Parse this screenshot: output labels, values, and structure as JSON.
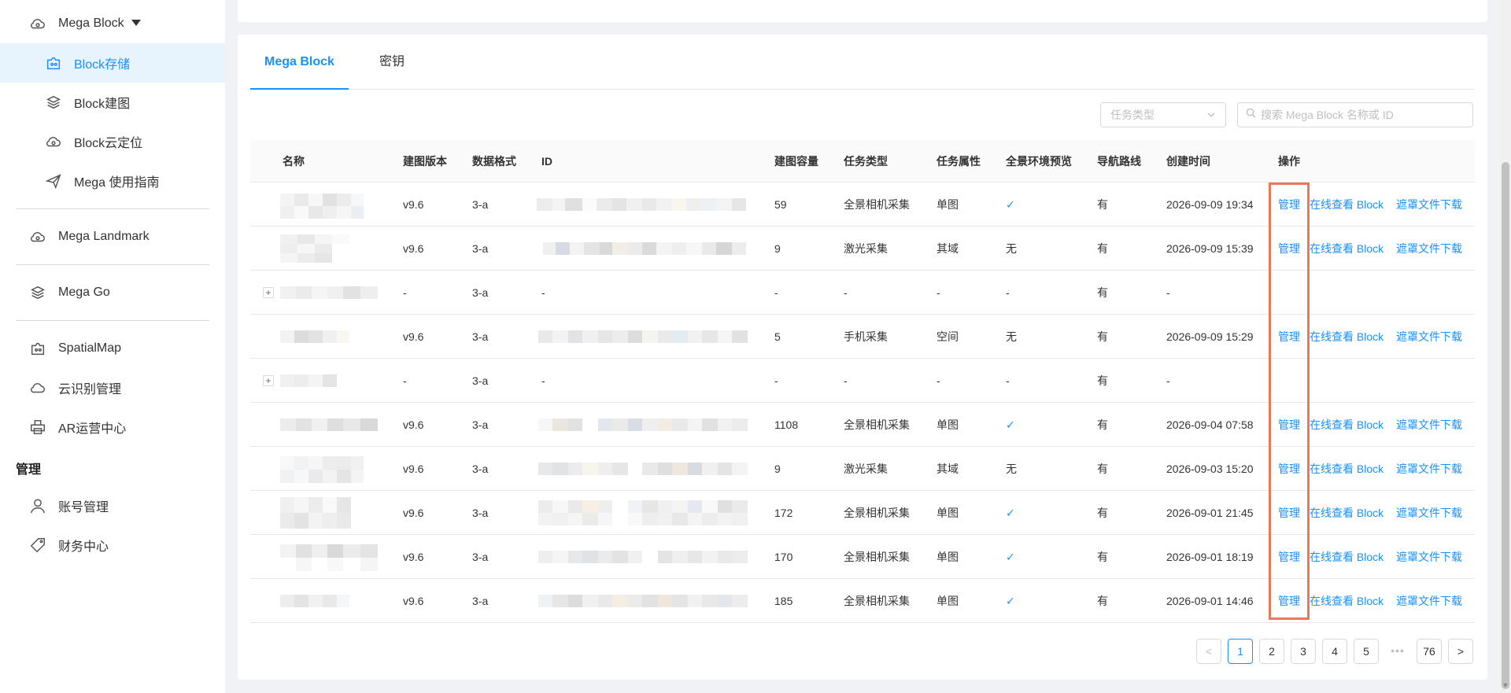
{
  "sidebar": {
    "items": [
      {
        "label": "Mega Block",
        "icon": "cloud-icon"
      },
      {
        "label": "Block存储",
        "icon": "block-storage-icon"
      },
      {
        "label": "Block建图",
        "icon": "layers-icon"
      },
      {
        "label": "Block云定位",
        "icon": "cloud-icon"
      },
      {
        "label": "Mega 使用指南",
        "icon": "send-icon"
      },
      {
        "label": "Mega Landmark",
        "icon": "cloud-icon"
      },
      {
        "label": "Mega Go",
        "icon": "layers-icon"
      },
      {
        "label": "SpatialMap",
        "icon": "spatial-icon"
      },
      {
        "label": "云识别管理",
        "icon": "cloud-outline-icon"
      },
      {
        "label": "AR运营中心",
        "icon": "printer-icon"
      },
      {
        "label": "账号管理",
        "icon": "user-icon"
      },
      {
        "label": "财务中心",
        "icon": "tag-icon"
      }
    ],
    "section_manage": "管理"
  },
  "tabs": [
    {
      "label": "Mega Block"
    },
    {
      "label": "密钥"
    }
  ],
  "filters": {
    "task_type_placeholder": "任务类型",
    "search_placeholder": "搜索 Mega Block 名称或 ID"
  },
  "table": {
    "headers": [
      "名称",
      "建图版本",
      "数据格式",
      "ID",
      "建图容量",
      "任务类型",
      "任务属性",
      "全景环境预览",
      "导航路线",
      "创建时间",
      "操作"
    ],
    "actions": {
      "manage": "管理",
      "view": "在线查看 Block",
      "download": "遮罩文件下载"
    },
    "rows": [
      {
        "version": "v9.6",
        "format": "3-a",
        "capacity": "59",
        "task_type": "全景相机采集",
        "task_attr": "单图",
        "pano": "✓",
        "nav": "有",
        "created": "2026-09-09 19:34",
        "expandable": false,
        "has_actions": true
      },
      {
        "version": "v9.6",
        "format": "3-a",
        "capacity": "9",
        "task_type": "激光采集",
        "task_attr": "其域",
        "pano": "无",
        "nav": "有",
        "created": "2026-09-09 15:39",
        "expandable": false,
        "has_actions": true
      },
      {
        "version": "-",
        "format": "3-a",
        "id_text": "-",
        "capacity": "-",
        "task_type": "-",
        "task_attr": "-",
        "pano": "-",
        "nav": "有",
        "created": "-",
        "expandable": true,
        "has_actions": false
      },
      {
        "version": "v9.6",
        "format": "3-a",
        "capacity": "5",
        "task_type": "手机采集",
        "task_attr": "空间",
        "pano": "无",
        "nav": "有",
        "created": "2026-09-09 15:29",
        "expandable": false,
        "has_actions": true
      },
      {
        "version": "-",
        "format": "3-a",
        "id_text": "-",
        "capacity": "-",
        "task_type": "-",
        "task_attr": "-",
        "pano": "-",
        "nav": "有",
        "created": "-",
        "expandable": true,
        "has_actions": false
      },
      {
        "version": "v9.6",
        "format": "3-a",
        "capacity": "1108",
        "task_type": "全景相机采集",
        "task_attr": "单图",
        "pano": "✓",
        "nav": "有",
        "created": "2026-09-04 07:58",
        "expandable": false,
        "has_actions": true
      },
      {
        "version": "v9.6",
        "format": "3-a",
        "capacity": "9",
        "task_type": "激光采集",
        "task_attr": "其域",
        "pano": "无",
        "nav": "有",
        "created": "2026-09-03 15:20",
        "expandable": false,
        "has_actions": true
      },
      {
        "version": "v9.6",
        "format": "3-a",
        "capacity": "172",
        "task_type": "全景相机采集",
        "task_attr": "单图",
        "pano": "✓",
        "nav": "有",
        "created": "2026-09-01 21:45",
        "expandable": false,
        "has_actions": true
      },
      {
        "version": "v9.6",
        "format": "3-a",
        "capacity": "170",
        "task_type": "全景相机采集",
        "task_attr": "单图",
        "pano": "✓",
        "nav": "有",
        "created": "2026-09-01 18:19",
        "expandable": false,
        "has_actions": true
      },
      {
        "version": "v9.6",
        "format": "3-a",
        "capacity": "185",
        "task_type": "全景相机采集",
        "task_attr": "单图",
        "pano": "✓",
        "nav": "有",
        "created": "2026-09-01 14:46",
        "expandable": false,
        "has_actions": true
      }
    ]
  },
  "pagination": {
    "prev": "<",
    "pages": [
      "1",
      "2",
      "3",
      "4",
      "5"
    ],
    "ellipsis": "•••",
    "last": "76",
    "next": ">",
    "current": "1"
  },
  "colors": {
    "accent": "#1890ff",
    "highlight_box": "#e8795a",
    "sidebar_active_bg": "#e8f4fd"
  }
}
